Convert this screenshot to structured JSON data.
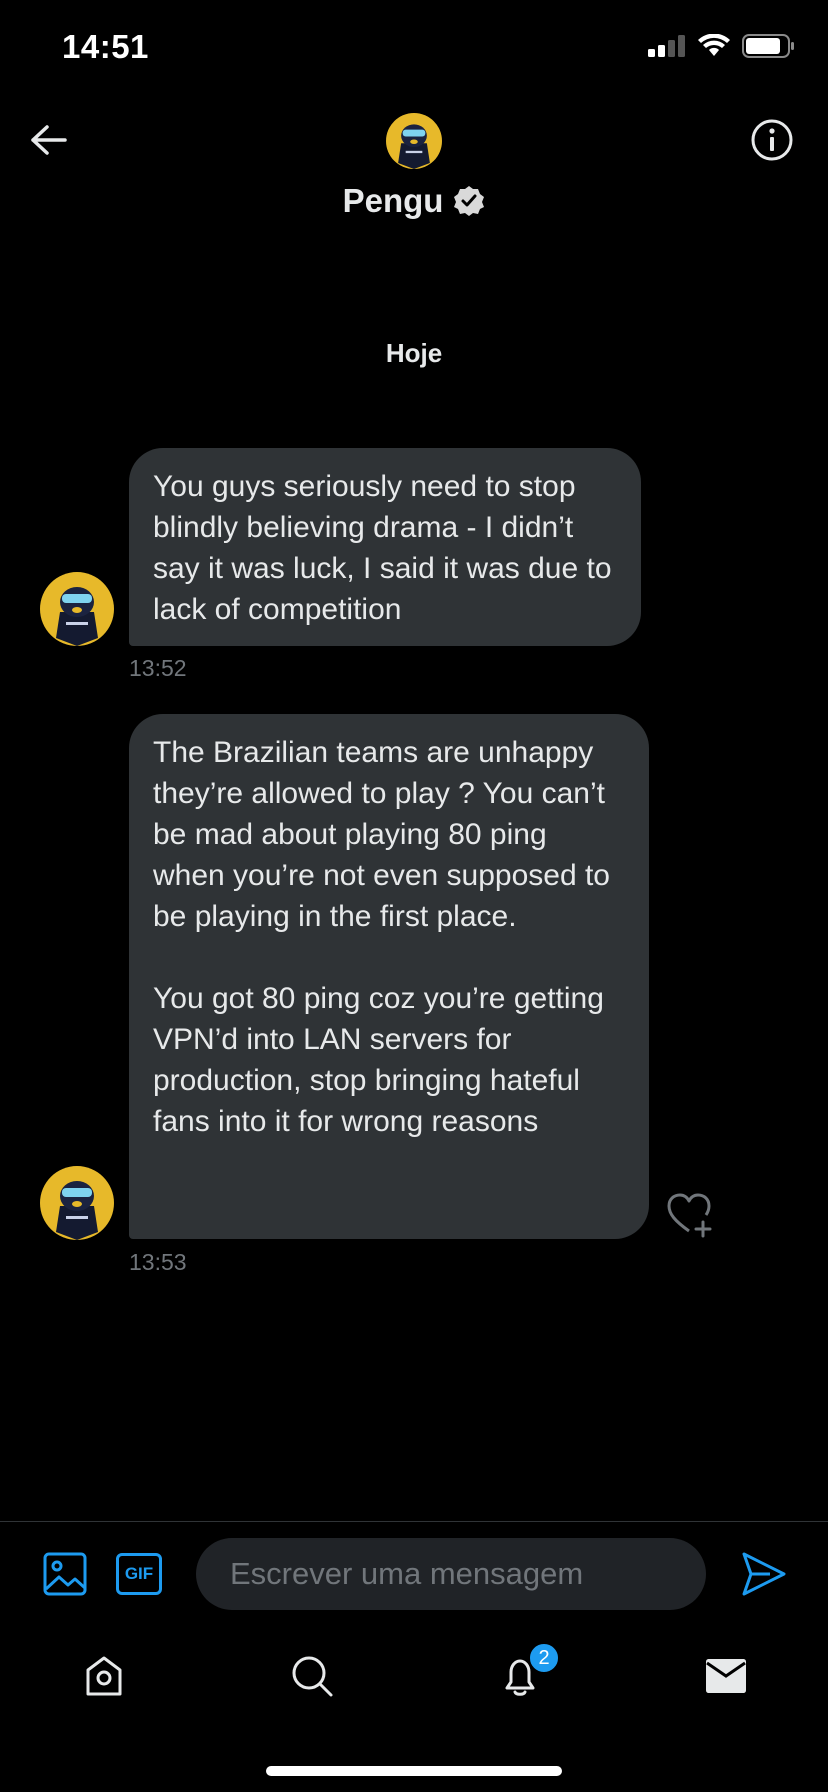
{
  "status_bar": {
    "time": "14:51"
  },
  "header": {
    "name": "Pengu",
    "verified": true
  },
  "date_separator": "Hoje",
  "messages": [
    {
      "text": "You guys seriously need to stop blindly believing drama - I didn’t say it was luck, I said it was due to lack of competition",
      "time": "13:52"
    },
    {
      "text": "The Brazilian teams are unhappy they’re allowed to play ? You can’t be mad about playing 80 ping when you’re not even supposed to be playing in the first place.\n\nYou got 80 ping coz you’re getting VPN’d into LAN servers for production, stop bringing hateful fans into it for wrong reasons",
      "time": "13:53"
    }
  ],
  "composer": {
    "gif_label": "GIF",
    "placeholder": "Escrever uma mensagem"
  },
  "tab_bar": {
    "notifications_badge": "2"
  },
  "colors": {
    "accent": "#1d9bf0",
    "bubble": "#2f3336",
    "background": "#000000",
    "muted": "#71767b"
  }
}
